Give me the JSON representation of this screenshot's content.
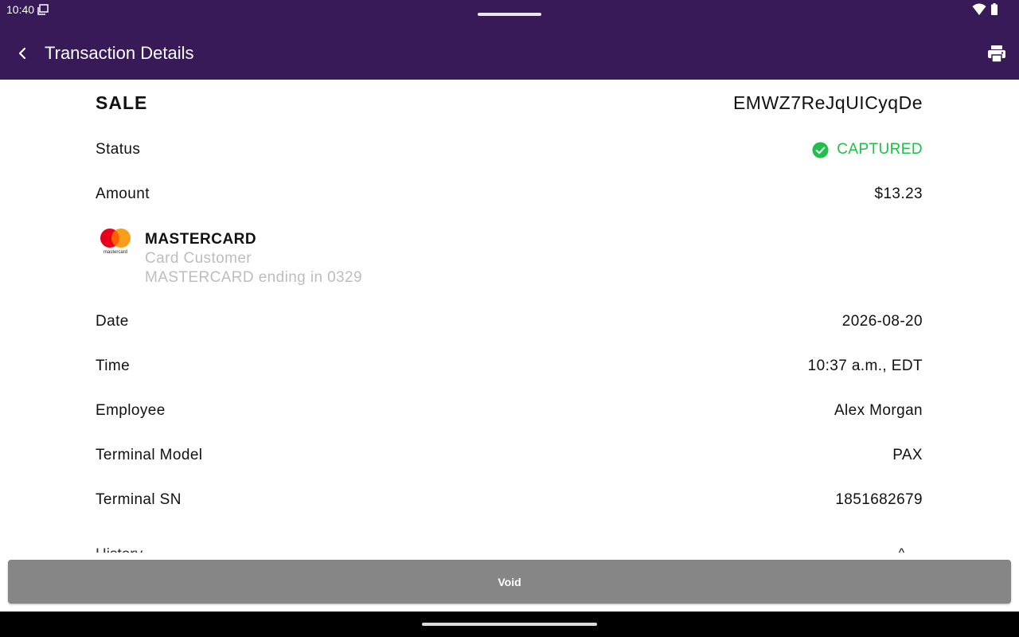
{
  "status_bar": {
    "time": "10:40",
    "icons": [
      "screen-icon",
      "wifi-icon",
      "battery-icon"
    ]
  },
  "app_bar": {
    "title": "Transaction Details",
    "background": "#371a57",
    "back_icon": "chevron-left-icon",
    "print_icon": "printer-icon"
  },
  "transaction": {
    "type": "SALE",
    "id": "EMWZ7ReJqUICyqDe",
    "status_label": "Status",
    "status_value": "CAPTURED",
    "status_color": "#1ec04b",
    "amount_label": "Amount",
    "amount_value": "$13.23"
  },
  "card": {
    "logo_text": "mastercard",
    "brand": "MASTERCARD",
    "holder": "Card Customer",
    "ending": "MASTERCARD ending in 0329"
  },
  "details": [
    {
      "label": "Date",
      "value": "2026-08-20"
    },
    {
      "label": "Time",
      "value": "10:37 a.m., EDT"
    },
    {
      "label": "Employee",
      "value": "Alex Morgan"
    },
    {
      "label": "Terminal Model",
      "value": "PAX"
    },
    {
      "label": "Terminal SN",
      "value": "1851682679"
    }
  ],
  "history": {
    "label": "History",
    "value": "^"
  },
  "void_button": {
    "label": "Void",
    "color": "#868686"
  }
}
